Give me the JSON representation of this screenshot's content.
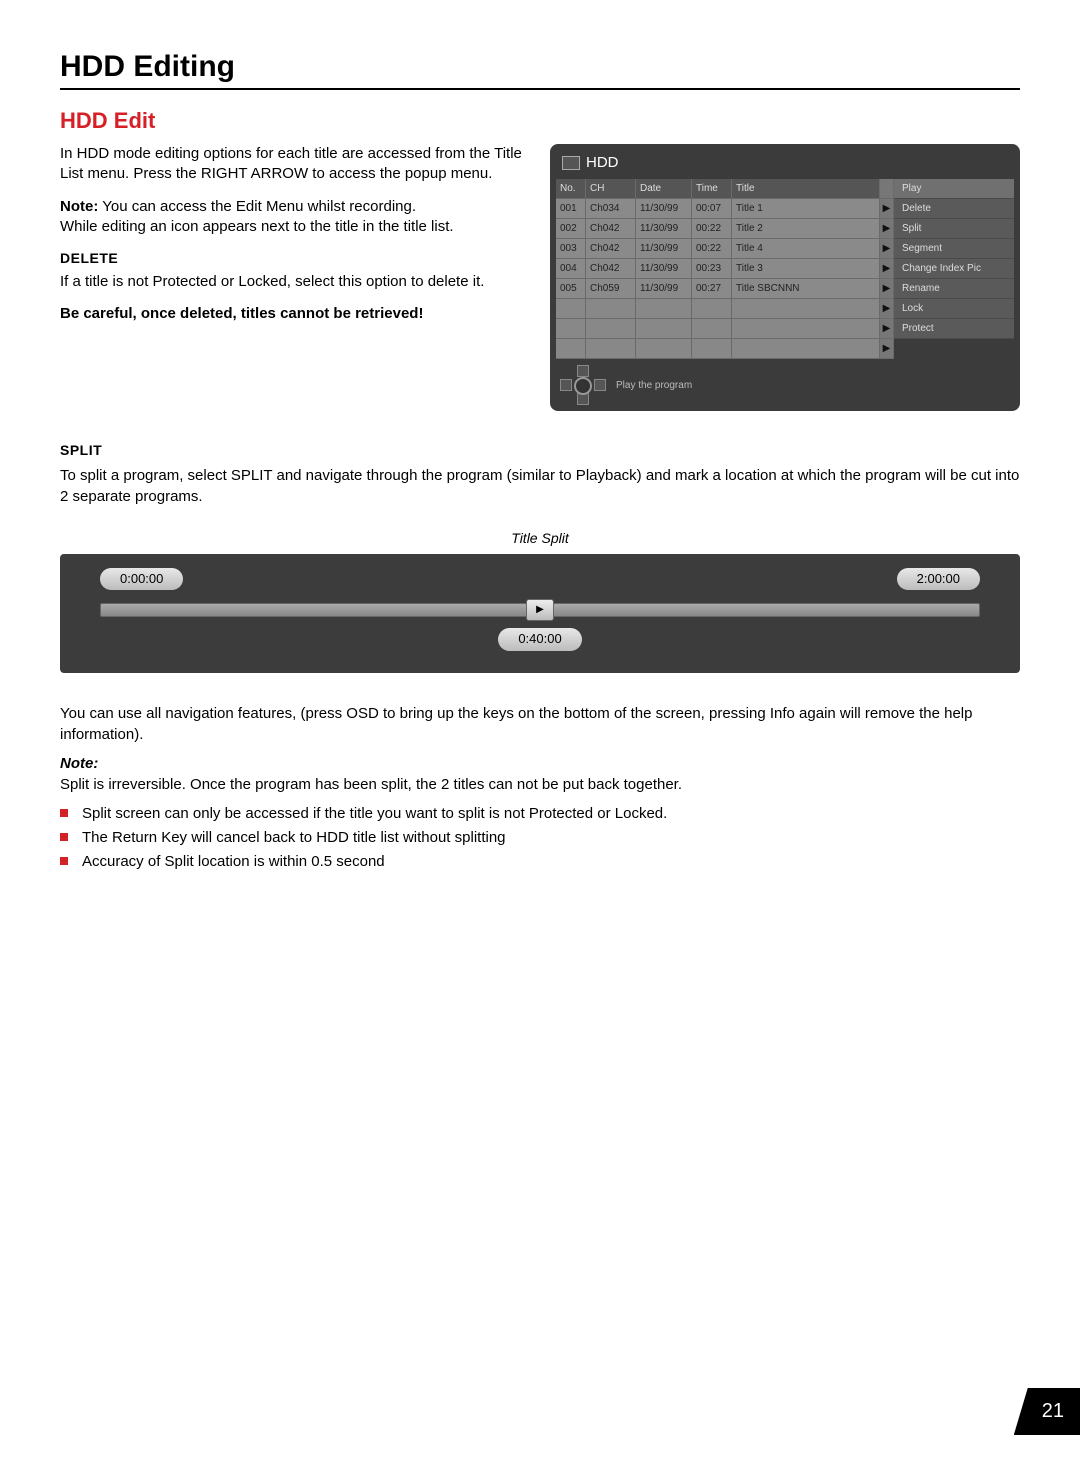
{
  "heading": "HDD Editing",
  "subheading": "HDD Edit",
  "intro": {
    "p1": "In HDD mode editing options for each title are accessed from the Title List menu. Press the RIGHT ARROW to access the popup menu.",
    "note_label": "Note:",
    "note_text": " You can access the Edit Menu whilst recording.",
    "p2": "While editing an icon appears next to the title in the title list."
  },
  "delete": {
    "heading": "DELETE",
    "p1": "If a title is not Protected or Locked, select this option to delete it.",
    "warn": "Be careful, once deleted, titles cannot be retrieved!"
  },
  "osd": {
    "title": "HDD",
    "headers": {
      "no": "No.",
      "ch": "CH",
      "date": "Date",
      "time": "Time",
      "title": "Title"
    },
    "rows": [
      {
        "no": "001",
        "ch": "Ch034",
        "date": "11/30/99",
        "time": "00:07",
        "title": "Title 1"
      },
      {
        "no": "002",
        "ch": "Ch042",
        "date": "11/30/99",
        "time": "00:22",
        "title": "Title 2"
      },
      {
        "no": "003",
        "ch": "Ch042",
        "date": "11/30/99",
        "time": "00:22",
        "title": "Title 4"
      },
      {
        "no": "004",
        "ch": "Ch042",
        "date": "11/30/99",
        "time": "00:23",
        "title": "Title 3"
      },
      {
        "no": "005",
        "ch": "Ch059",
        "date": "11/30/99",
        "time": "00:27",
        "title": "Title SBCNNN"
      }
    ],
    "side": [
      "Play",
      "Delete",
      "Split",
      "Segment",
      "Change Index Pic",
      "Rename",
      "Lock",
      "Protect"
    ],
    "footer_hint": "Play the program",
    "arrow": "▶"
  },
  "split": {
    "heading": "SPLIT",
    "p1": "To split a program, select SPLIT and navigate through the program (similar to Playback) and mark a location at which the program will be cut into 2 separate programs.",
    "diagram_label": "Title Split",
    "t_start": "0:00:00",
    "t_end": "2:00:00",
    "t_cur": "0:40:00",
    "p2": "You can use all navigation features, (press OSD to bring up the keys on the bottom of the screen, pressing Info again will remove the help information).",
    "note_label": "Note:",
    "note_text": "Split is irreversible. Once the program has been split, the 2 titles can not be put back together.",
    "bullets": [
      "Split screen can only be accessed if the title you want to split is not Protected or Locked.",
      "The Return Key will cancel back to HDD title list without splitting",
      "Accuracy of Split location is within 0.5 second"
    ]
  },
  "page_number": "21"
}
